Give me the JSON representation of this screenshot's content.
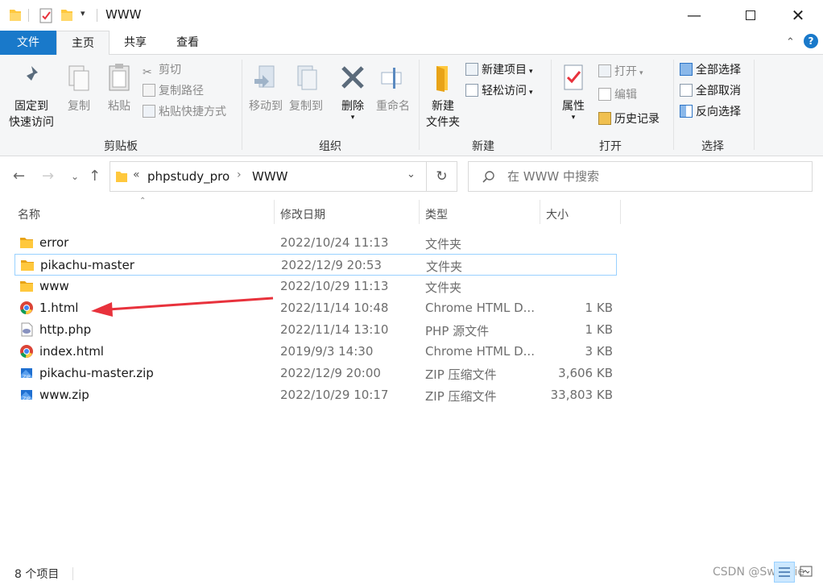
{
  "window": {
    "title": "WWW"
  },
  "ribbon_tabs": [
    "文件",
    "主页",
    "共享",
    "查看"
  ],
  "ribbon": {
    "clipboard": {
      "pin_label": "固定到",
      "pin_label2": "快速访问",
      "copy_label": "复制",
      "paste_label": "粘贴",
      "cut_label": "剪切",
      "copy_path_label": "复制路径",
      "paste_shortcut_label": "粘贴快捷方式",
      "group_label": "剪贴板"
    },
    "organize": {
      "move_to_label": "移动到",
      "copy_to_label": "复制到",
      "delete_label": "删除",
      "rename_label": "重命名",
      "group_label": "组织"
    },
    "new": {
      "new_folder_label": "新建",
      "new_folder_label2": "文件夹",
      "new_item_label": "新建项目",
      "easy_access_label": "轻松访问",
      "group_label": "新建"
    },
    "open": {
      "properties_label": "属性",
      "open_label": "打开",
      "edit_label": "编辑",
      "history_label": "历史记录",
      "group_label": "打开"
    },
    "select": {
      "select_all_label": "全部选择",
      "select_none_label": "全部取消",
      "invert_label": "反向选择",
      "group_label": "选择"
    }
  },
  "address": {
    "overflow": "«",
    "crumbs": [
      "phpstudy_pro",
      "WWW"
    ],
    "sep": "›"
  },
  "search": {
    "placeholder": "在 WWW 中搜索"
  },
  "columns": {
    "name": "名称",
    "date": "修改日期",
    "type": "类型",
    "size": "大小"
  },
  "files": [
    {
      "name": "error",
      "date": "2022/10/24 11:13",
      "type": "文件夹",
      "size": "",
      "icon": "folder-icon"
    },
    {
      "name": "pikachu-master",
      "date": "2022/12/9 20:53",
      "type": "文件夹",
      "size": "",
      "icon": "folder-icon"
    },
    {
      "name": "www",
      "date": "2022/10/29 11:13",
      "type": "文件夹",
      "size": "",
      "icon": "folder-icon"
    },
    {
      "name": "1.html",
      "date": "2022/11/14 10:48",
      "type": "Chrome HTML D...",
      "size": "1 KB",
      "icon": "chrome-icon"
    },
    {
      "name": "http.php",
      "date": "2022/11/14 13:10",
      "type": "PHP 源文件",
      "size": "1 KB",
      "icon": "php-file-icon"
    },
    {
      "name": "index.html",
      "date": "2019/9/3 14:30",
      "type": "Chrome HTML D...",
      "size": "3 KB",
      "icon": "chrome-icon"
    },
    {
      "name": "pikachu-master.zip",
      "date": "2022/12/9 20:00",
      "type": "ZIP 压缩文件",
      "size": "3,606 KB",
      "icon": "zip-icon"
    },
    {
      "name": "www.zip",
      "date": "2022/10/29 10:17",
      "type": "ZIP 压缩文件",
      "size": "33,803 KB",
      "icon": "zip-icon"
    }
  ],
  "status": {
    "count": "8 个项目"
  },
  "watermark": "CSDN @Swe|||ie",
  "colors": {
    "accent": "#1979ca",
    "folder": "#ffc83d",
    "arrow": "#e8323c",
    "selection_border": "#99d1ff"
  }
}
